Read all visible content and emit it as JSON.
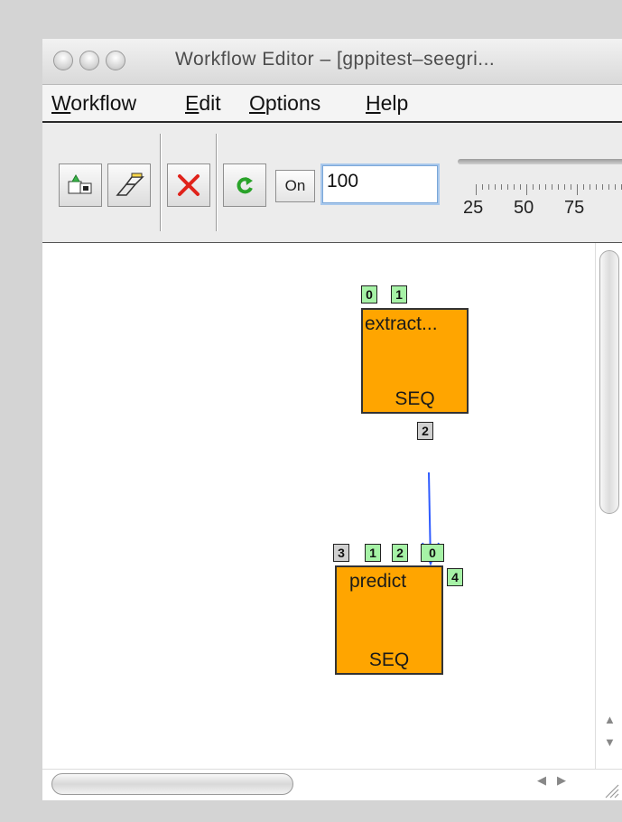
{
  "window": {
    "title": "Workflow Editor – [gppitest–seegri..."
  },
  "menu": [
    {
      "label": "Workflow",
      "mnemonic": "W",
      "rest": "orkflow"
    },
    {
      "label": "Edit",
      "mnemonic": "E",
      "rest": "dit"
    },
    {
      "label": "Options",
      "mnemonic": "O",
      "rest": "ptions"
    },
    {
      "label": "Help",
      "mnemonic": "H",
      "rest": "elp"
    }
  ],
  "toolbar": {
    "buttons": [
      "export-icon",
      "connect-icon",
      "delete-icon",
      "refresh-icon"
    ],
    "on_label": "On",
    "value": "100",
    "slider_labels": [
      "25",
      "50",
      "75"
    ]
  },
  "nodes": [
    {
      "name": "extract...",
      "kind": "SEQ",
      "in_ports": [
        "0",
        "1"
      ],
      "out_ports": [
        "2"
      ]
    },
    {
      "name": "predict",
      "kind": "SEQ",
      "in_ports": [
        "1",
        "2",
        "0"
      ],
      "out_ports": [
        "3",
        "4"
      ]
    }
  ],
  "colors": {
    "node": "#ffa500",
    "in_port": "#a6f2a6",
    "out_port": "#d0d0d0",
    "link": "#2f5bff"
  }
}
